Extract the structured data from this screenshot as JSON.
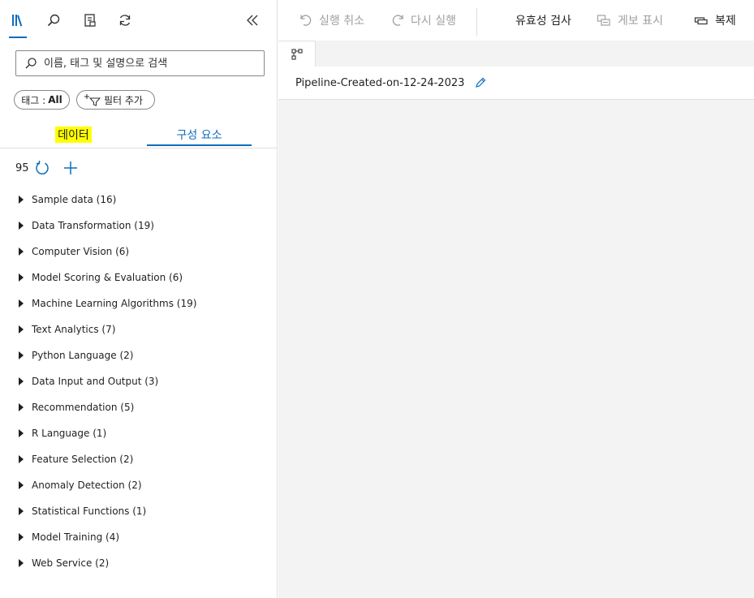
{
  "left_panel": {
    "search": {
      "placeholder": "이름, 태그 및 설명으로 검색"
    },
    "tag_filter": {
      "label": "태그 :",
      "value": "All"
    },
    "add_filter_label": "필터 추가",
    "tabs": [
      {
        "label": "데이터",
        "selected": false,
        "highlight_color": "#ffff00"
      },
      {
        "label": "구성 요소",
        "selected": true
      }
    ],
    "count": "95",
    "tree_items": [
      {
        "label": "Sample data (16)"
      },
      {
        "label": "Data Transformation (19)"
      },
      {
        "label": "Computer Vision (6)"
      },
      {
        "label": "Model Scoring & Evaluation (6)"
      },
      {
        "label": "Machine Learning Algorithms (19)"
      },
      {
        "label": "Text Analytics (7)"
      },
      {
        "label": "Python Language (2)"
      },
      {
        "label": "Data Input and Output (3)"
      },
      {
        "label": "Recommendation (5)"
      },
      {
        "label": "R Language (1)"
      },
      {
        "label": "Feature Selection (2)"
      },
      {
        "label": "Anomaly Detection (2)"
      },
      {
        "label": "Statistical Functions (1)"
      },
      {
        "label": "Model Training (4)"
      },
      {
        "label": "Web Service (2)"
      }
    ]
  },
  "toolbar": {
    "undo_label": "실행 취소",
    "redo_label": "다시 실행",
    "validate_label": "유효성 검사",
    "publish_label": "게보 표시",
    "clone_label": "복제"
  },
  "pipeline": {
    "title": "Pipeline-Created-on-12-24-2023"
  },
  "colors": {
    "accent": "#0f6cbd",
    "disabled": "#a19f9d",
    "canvas": "#f3f3f3"
  }
}
